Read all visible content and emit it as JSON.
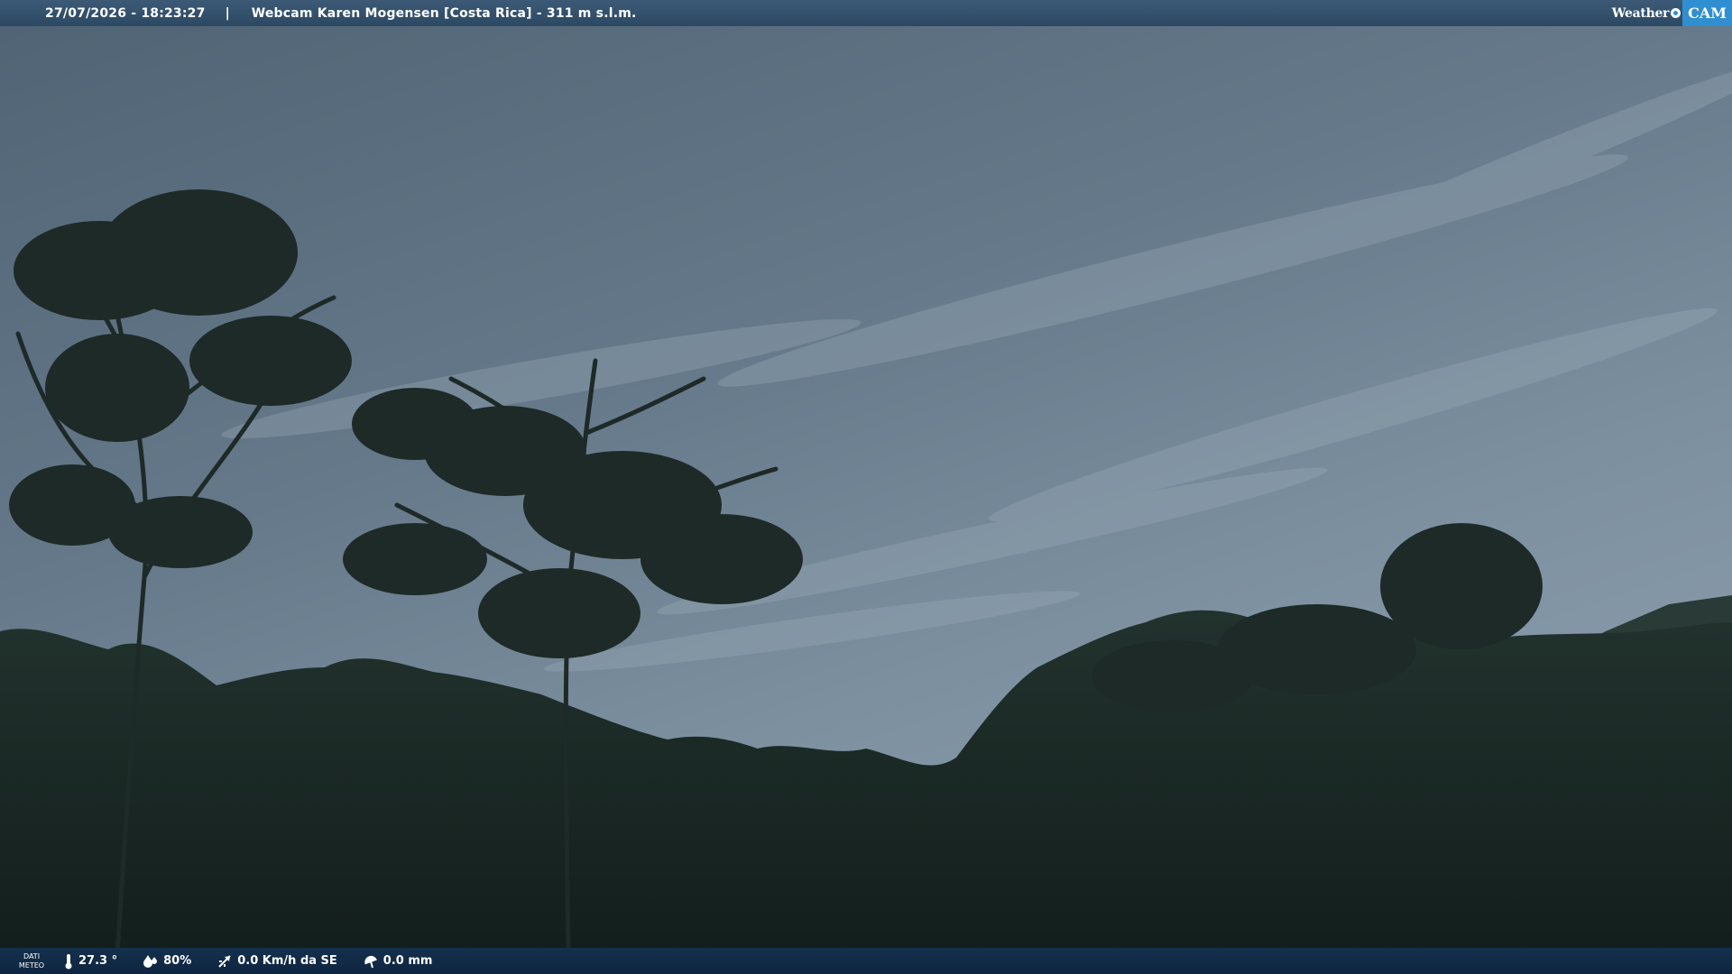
{
  "header": {
    "datetime": "27/07/2026 - 18:23:27",
    "separator": "|",
    "title": "Webcam Karen Mogensen [Costa Rica]  - 311 m s.l.m.",
    "logo_word": "Weather",
    "logo_cam": "CAM"
  },
  "footer": {
    "label_line1": "DATI",
    "label_line2": "METEO",
    "temperature": "27.3 °",
    "humidity": "80%",
    "wind": "0.0 Km/h da SE",
    "rain": "0.0 mm"
  },
  "colors": {
    "sky": "#64798a",
    "foliage": "#1a2b26",
    "topbar": "#2f4b66",
    "bottombar": "#122b46",
    "logo_accent": "#2f8fd0"
  }
}
